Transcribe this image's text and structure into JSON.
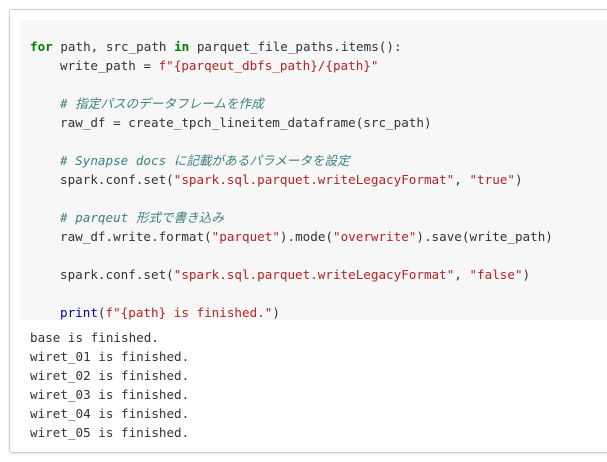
{
  "code": {
    "lines": [
      [
        {
          "c": "kw",
          "t": "for"
        },
        {
          "c": "plain",
          "t": " path, src_path "
        },
        {
          "c": "kw",
          "t": "in"
        },
        {
          "c": "plain",
          "t": " parquet_file_paths.items():"
        }
      ],
      [
        {
          "c": "ind",
          "t": ""
        },
        {
          "c": "plain",
          "t": "write_path = "
        },
        {
          "c": "str",
          "t": "f\"{parqeut_dbfs_path}/{path}\""
        }
      ],
      [],
      [
        {
          "c": "ind",
          "t": ""
        },
        {
          "c": "cm",
          "t": "# 指定パスのデータフレームを作成"
        }
      ],
      [
        {
          "c": "ind",
          "t": ""
        },
        {
          "c": "plain",
          "t": "raw_df = create_tpch_lineitem_dataframe(src_path)"
        }
      ],
      [],
      [
        {
          "c": "ind",
          "t": ""
        },
        {
          "c": "cm",
          "t": "# Synapse docs に記載があるパラメータを設定"
        }
      ],
      [
        {
          "c": "ind",
          "t": ""
        },
        {
          "c": "plain",
          "t": "spark.conf.set("
        },
        {
          "c": "str",
          "t": "\"spark.sql.parquet.writeLegacyFormat\""
        },
        {
          "c": "plain",
          "t": ", "
        },
        {
          "c": "str",
          "t": "\"true\""
        },
        {
          "c": "plain",
          "t": ")"
        }
      ],
      [],
      [
        {
          "c": "ind",
          "t": ""
        },
        {
          "c": "cm",
          "t": "# parqeut 形式で書き込み"
        }
      ],
      [
        {
          "c": "ind",
          "t": ""
        },
        {
          "c": "plain",
          "t": "raw_df.write.format("
        },
        {
          "c": "str",
          "t": "\"parquet\""
        },
        {
          "c": "plain",
          "t": ").mode("
        },
        {
          "c": "str",
          "t": "\"overwrite\""
        },
        {
          "c": "plain",
          "t": ").save(write_path)"
        }
      ],
      [],
      [
        {
          "c": "ind",
          "t": ""
        },
        {
          "c": "plain",
          "t": "spark.conf.set("
        },
        {
          "c": "str",
          "t": "\"spark.sql.parquet.writeLegacyFormat\""
        },
        {
          "c": "plain",
          "t": ", "
        },
        {
          "c": "str",
          "t": "\"false\""
        },
        {
          "c": "plain",
          "t": ")"
        }
      ],
      [],
      [
        {
          "c": "ind",
          "t": ""
        },
        {
          "c": "fn",
          "t": "print"
        },
        {
          "c": "plain",
          "t": "("
        },
        {
          "c": "str",
          "t": "f\"{path} is finished.\""
        },
        {
          "c": "plain",
          "t": ")"
        }
      ]
    ]
  },
  "output": {
    "lines": [
      "base is finished.",
      "wiret_01 is finished.",
      "wiret_02 is finished.",
      "wiret_03 is finished.",
      "wiret_04 is finished.",
      "wiret_05 is finished."
    ]
  }
}
